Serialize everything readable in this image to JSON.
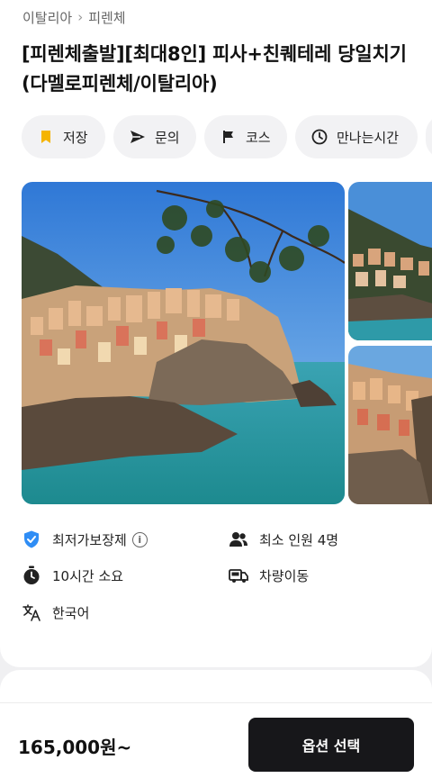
{
  "breadcrumb": {
    "country": "이탈리아",
    "separator": "›",
    "city": "피렌체"
  },
  "title": "[피렌체출발][최대8인] 피사+친퀘테레 당일치기 (다멜로피렌체/이탈리아)",
  "actions": [
    {
      "label": "저장",
      "icon": "bookmark-icon"
    },
    {
      "label": "문의",
      "icon": "send-icon"
    },
    {
      "label": "코스",
      "icon": "flag-icon"
    },
    {
      "label": "만나는시간",
      "icon": "clock-icon"
    }
  ],
  "info": {
    "price_guarantee": "최저가보장제",
    "min_people": "최소 인원 4명",
    "duration": "10시간 소요",
    "transport": "차량이동",
    "language": "한국어"
  },
  "footer": {
    "price": "165,000원~",
    "cta_label": "옵션 선택"
  },
  "colors": {
    "accent_bookmark": "#f5b400",
    "shield": "#2f8df5",
    "cta_bg": "#17171a"
  }
}
